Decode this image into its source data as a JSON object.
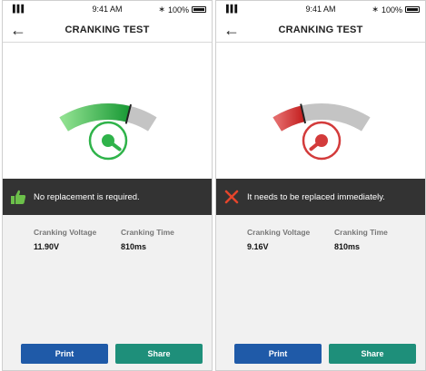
{
  "statusbar": {
    "signal": "▐▐▐",
    "time": "9:41 AM",
    "battery": "100%"
  },
  "screens": [
    {
      "title": "CRANKING TEST",
      "message": "No replacement is required.",
      "result": "pass",
      "gauge_level": 0.72,
      "accent": "#2fb34a",
      "metrics": [
        {
          "label": "Cranking Voltage",
          "value": "11.90V"
        },
        {
          "label": "Cranking Time",
          "value": "810ms"
        }
      ],
      "print_label": "Print",
      "share_label": "Share"
    },
    {
      "title": "CRANKING TEST",
      "message": "It needs to be replaced immediately.",
      "result": "fail",
      "gauge_level": 0.3,
      "accent": "#d33b3b",
      "metrics": [
        {
          "label": "Cranking Voltage",
          "value": "9.16V"
        },
        {
          "label": "Cranking Time",
          "value": "810ms"
        }
      ],
      "print_label": "Print",
      "share_label": "Share"
    }
  ]
}
